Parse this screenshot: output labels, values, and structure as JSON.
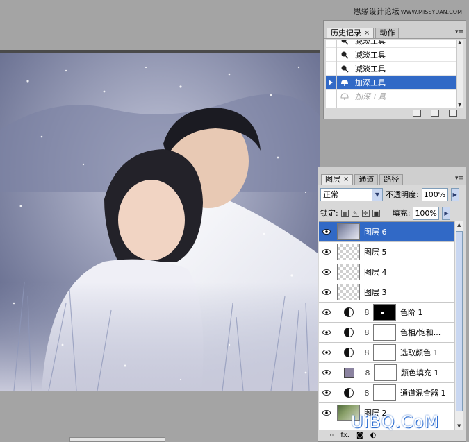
{
  "watermark_top": {
    "text": "思缘设计论坛",
    "domain": "WWW.MISSYUAN.COM"
  },
  "watermark_bottom": "UiBQ.CoM",
  "colors": {
    "selection": "#3169c6",
    "panel_bg": "#d8d8d8",
    "workspace": "#a4a4a4",
    "fill_swatch": "#8b83a0"
  },
  "history_panel": {
    "tabs": [
      {
        "label": "历史记录",
        "active": true
      },
      {
        "label": "动作",
        "active": false
      }
    ],
    "close_glyph": "×",
    "items": [
      {
        "label": "减淡工具",
        "icon": "dodge-tool-icon"
      },
      {
        "label": "减淡工具",
        "icon": "dodge-tool-icon"
      },
      {
        "label": "减淡工具",
        "icon": "dodge-tool-icon"
      },
      {
        "label": "加深工具",
        "icon": "burn-tool-icon",
        "selected": true
      },
      {
        "label": "加深工具",
        "icon": "burn-tool-icon",
        "dimmed": true
      }
    ],
    "footer_icons": [
      "new-document-from-state-icon",
      "snapshot-icon",
      "trash-icon"
    ]
  },
  "layers_panel": {
    "tabs": [
      {
        "label": "图层",
        "active": true
      },
      {
        "label": "通道",
        "active": false
      },
      {
        "label": "路径",
        "active": false
      }
    ],
    "close_glyph": "×",
    "blend_mode": "正常",
    "opacity_label": "不透明度:",
    "opacity_value": "100%",
    "lock_label": "锁定:",
    "fill_label": "填充:",
    "fill_value": "100%",
    "layers": [
      {
        "name": "图层 6",
        "thumb": "photo",
        "selected": true
      },
      {
        "name": "图层 5",
        "thumb": "checker"
      },
      {
        "name": "图层 4",
        "thumb": "checker"
      },
      {
        "name": "图层 3",
        "thumb": "checker"
      },
      {
        "name": "色阶 1",
        "thumb": "adjustment",
        "mask": "black"
      },
      {
        "name": "色相/饱和...",
        "thumb": "adjustment",
        "mask": "white"
      },
      {
        "name": "选取颜色 1",
        "thumb": "adjustment",
        "mask": "white"
      },
      {
        "name": "颜色填充 1",
        "thumb": "fill",
        "mask": "white"
      },
      {
        "name": "通道混合器 1",
        "thumb": "adjustment",
        "mask": "white"
      },
      {
        "name": "图层 2",
        "thumb": "photo2"
      }
    ],
    "footer_icons": [
      "link-layers-icon",
      "fx-icon",
      "add-mask-icon",
      "new-adjustment-icon",
      "new-group-icon",
      "new-layer-icon",
      "trash-icon"
    ],
    "footer_fx": "fx."
  }
}
